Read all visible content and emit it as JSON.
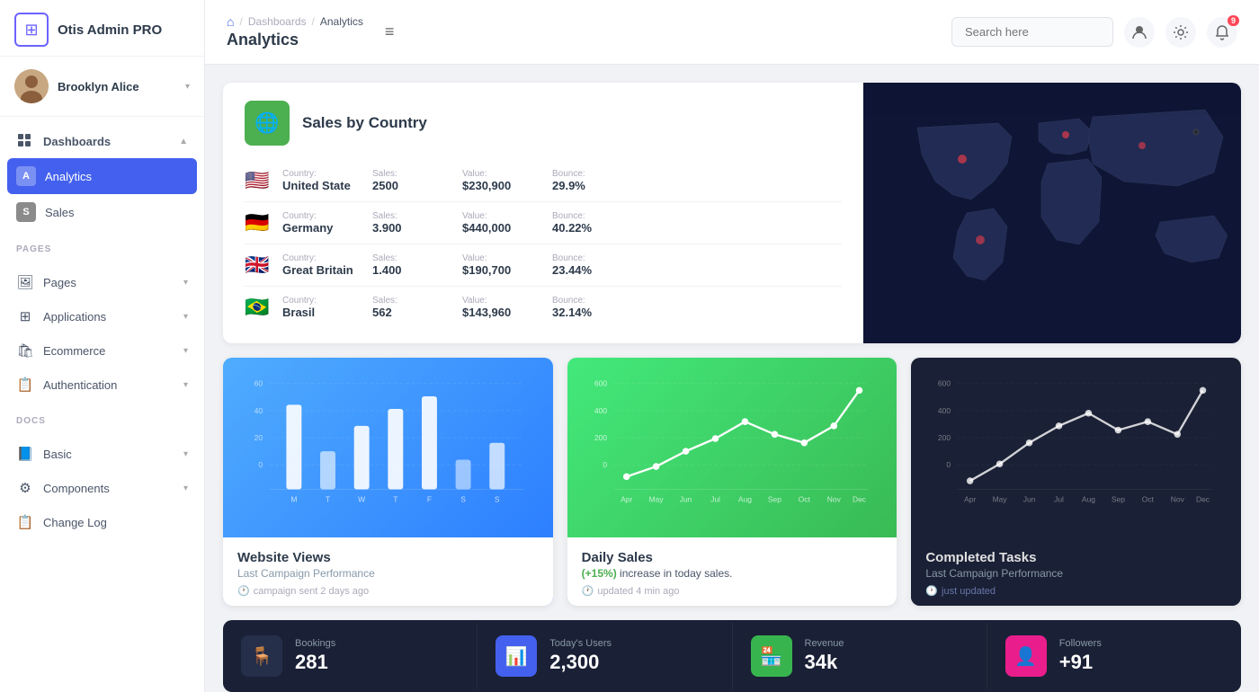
{
  "sidebar": {
    "logo": {
      "text": "Otis Admin PRO",
      "icon": "⊞"
    },
    "profile": {
      "name": "Brooklyn Alice",
      "chevron": "▾"
    },
    "nav": {
      "dashboards_label": "Dashboards",
      "dashboards_chevron": "▲",
      "analytics_label": "Analytics",
      "analytics_letter": "A",
      "sales_label": "Sales",
      "sales_letter": "S"
    },
    "pages_section": "PAGES",
    "pages_items": [
      {
        "label": "Pages",
        "icon": "🖼"
      },
      {
        "label": "Applications",
        "icon": "⊞"
      },
      {
        "label": "Ecommerce",
        "icon": "🛍"
      },
      {
        "label": "Authentication",
        "icon": "📋"
      }
    ],
    "docs_section": "DOCS",
    "docs_items": [
      {
        "label": "Basic",
        "icon": "📘"
      },
      {
        "label": "Components",
        "icon": "⚙"
      },
      {
        "label": "Change Log",
        "icon": "📋"
      }
    ]
  },
  "header": {
    "home_icon": "⌂",
    "breadcrumb_sep1": "/",
    "breadcrumb_dash": "Dashboards",
    "breadcrumb_sep2": "/",
    "breadcrumb_current": "Analytics",
    "page_title": "Analytics",
    "menu_icon": "≡",
    "search_placeholder": "Search here",
    "notif_count": "9"
  },
  "sales_by_country": {
    "title": "Sales by Country",
    "icon": "🌐",
    "countries": [
      {
        "flag": "🇺🇸",
        "country_label": "Country:",
        "country_name": "United State",
        "sales_label": "Sales:",
        "sales_value": "2500",
        "value_label": "Value:",
        "value_value": "$230,900",
        "bounce_label": "Bounce:",
        "bounce_value": "29.9%"
      },
      {
        "flag": "🇩🇪",
        "country_label": "Country:",
        "country_name": "Germany",
        "sales_label": "Sales:",
        "sales_value": "3.900",
        "value_label": "Value:",
        "value_value": "$440,000",
        "bounce_label": "Bounce:",
        "bounce_value": "40.22%"
      },
      {
        "flag": "🇬🇧",
        "country_label": "Country:",
        "country_name": "Great Britain",
        "sales_label": "Sales:",
        "sales_value": "1.400",
        "value_label": "Value:",
        "value_value": "$190,700",
        "bounce_label": "Bounce:",
        "bounce_value": "23.44%"
      },
      {
        "flag": "🇧🇷",
        "country_label": "Country:",
        "country_name": "Brasil",
        "sales_label": "Sales:",
        "sales_value": "562",
        "value_label": "Value:",
        "value_value": "$143,960",
        "bounce_label": "Bounce:",
        "bounce_value": "32.14%"
      }
    ]
  },
  "website_views": {
    "title": "Website Views",
    "subtitle": "Last Campaign Performance",
    "meta": "campaign sent 2 days ago",
    "y_labels": [
      "60",
      "40",
      "20",
      "0"
    ],
    "x_labels": [
      "M",
      "T",
      "W",
      "T",
      "F",
      "S",
      "S"
    ]
  },
  "daily_sales": {
    "title": "Daily Sales",
    "subtitle_prefix": "(+15%)",
    "subtitle_suffix": " increase in today sales.",
    "meta": "updated 4 min ago",
    "y_labels": [
      "600",
      "400",
      "200",
      "0"
    ],
    "x_labels": [
      "Apr",
      "May",
      "Jun",
      "Jul",
      "Aug",
      "Sep",
      "Oct",
      "Nov",
      "Dec"
    ]
  },
  "completed_tasks": {
    "title": "Completed Tasks",
    "subtitle": "Last Campaign Performance",
    "meta": "just updated",
    "y_labels": [
      "600",
      "400",
      "200",
      "0"
    ],
    "x_labels": [
      "Apr",
      "May",
      "Jun",
      "Jul",
      "Aug",
      "Sep",
      "Oct",
      "Nov",
      "Dec"
    ]
  },
  "stats": [
    {
      "label": "Bookings",
      "value": "281",
      "icon": "🪑",
      "icon_class": "stat-icon-dark"
    },
    {
      "label": "Today's Users",
      "value": "2,300",
      "icon": "📊",
      "icon_class": "stat-icon-blue"
    },
    {
      "label": "Revenue",
      "value": "34k",
      "icon": "🏪",
      "icon_class": "stat-icon-green"
    },
    {
      "label": "Followers",
      "value": "+91",
      "icon": "👤",
      "icon_class": "stat-icon-pink"
    }
  ]
}
